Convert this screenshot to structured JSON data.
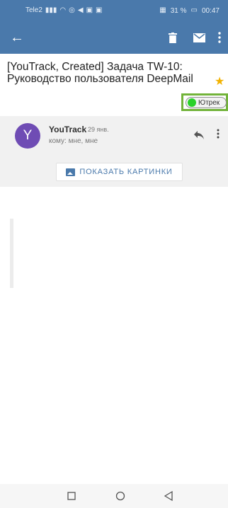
{
  "status": {
    "carrier": "Tele2",
    "signal_icon": "signal-icon",
    "battery_text": "31 %",
    "time": "00:47"
  },
  "appbar": {
    "back_icon": "arrow-back-icon",
    "delete_icon": "trash-icon",
    "mark_icon": "mail-icon",
    "more_icon": "more-vertical-icon"
  },
  "email": {
    "subject": "[YouTrack, Created] Задача TW-10: Руководство пользователя DeepMail",
    "label": "Ютрек",
    "starred": true
  },
  "message": {
    "avatar_letter": "Y",
    "sender": "YouTrack",
    "date": "29 янв.",
    "recipients": "кому: мне, мне"
  },
  "actions": {
    "show_images": "ПОКАЗАТЬ КАРТИНКИ"
  },
  "colors": {
    "brand": "#4a79ab",
    "avatar": "#6f4cb4",
    "label_dot": "#2ad12a",
    "highlight_frame": "#72b33a",
    "star": "#f2b200"
  }
}
